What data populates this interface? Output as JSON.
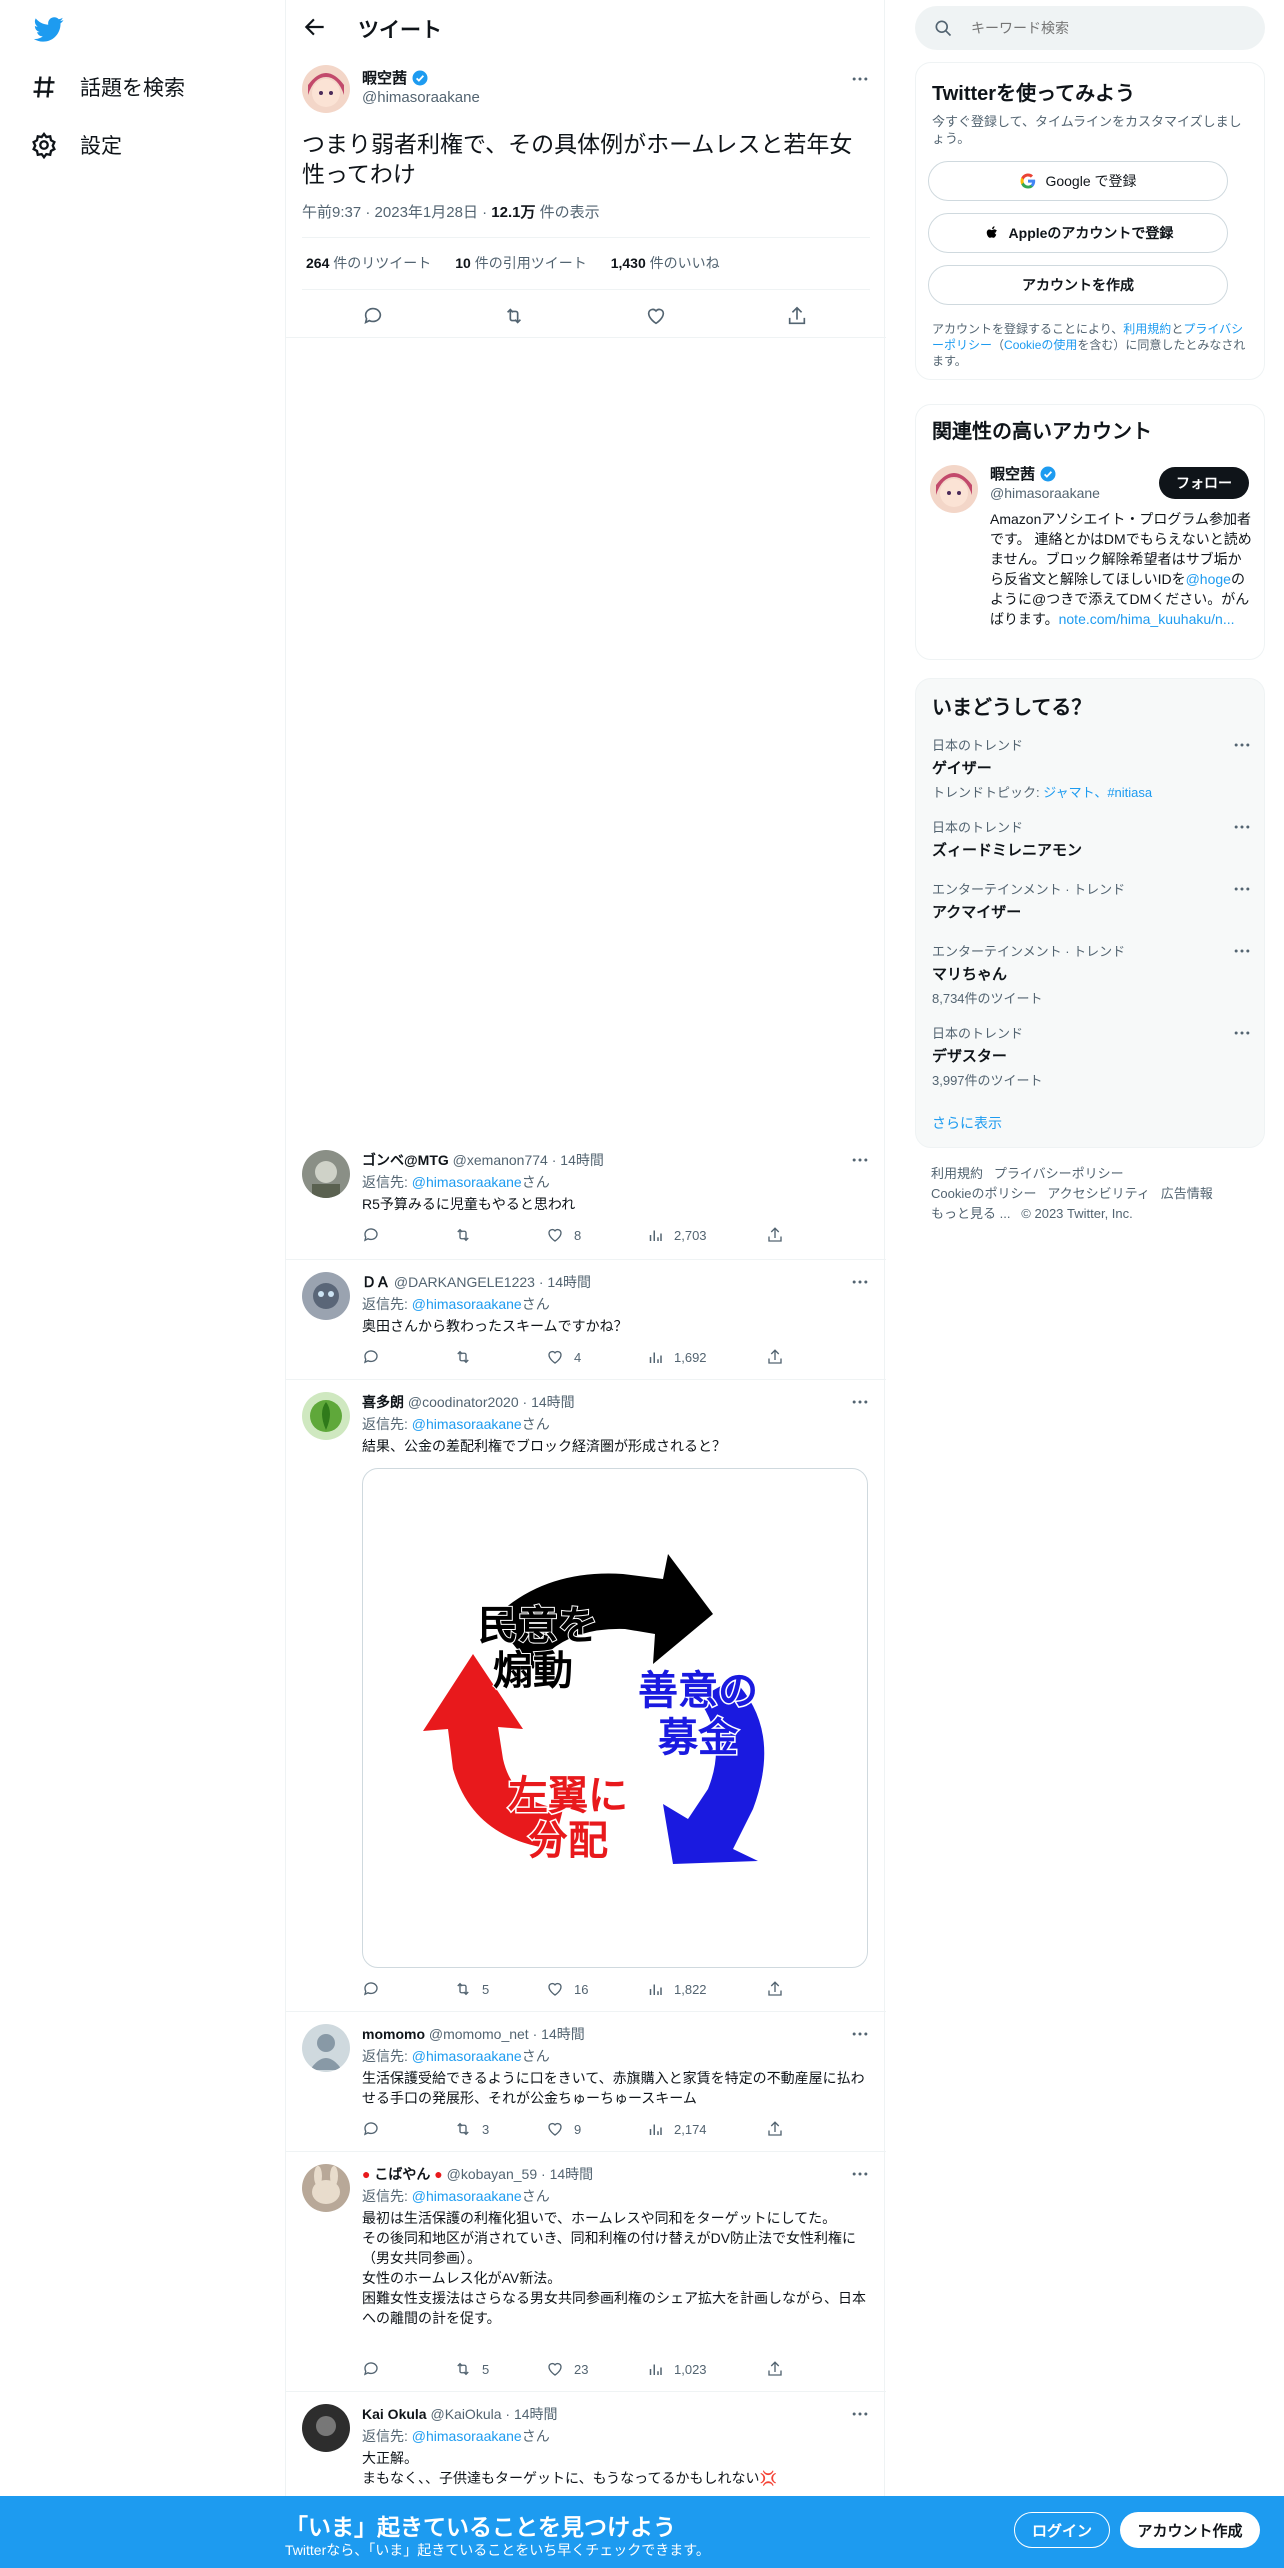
{
  "nav": {
    "explore_label": "話題を検索",
    "settings_label": "設定"
  },
  "header": {
    "title": "ツイート"
  },
  "main_tweet": {
    "name": "暇空茜",
    "handle": "@himasoraakane",
    "text": "つまり弱者利権で、その具体例がホームレスと若年女性ってわけ",
    "time": "午前9:37",
    "date": "2023年1月28日",
    "views_count": "12.1万",
    "views_label": "件の表示",
    "retweets_count": "264",
    "retweets_label": "件のリツイート",
    "quotes_count": "10",
    "quotes_label": "件の引用ツイート",
    "likes_count": "1,430",
    "likes_label": "件のいいね"
  },
  "replies": [
    {
      "name": "ゴンベ@MTG",
      "handle": "@xemanon774",
      "time": "14時間",
      "reply_prefix": "返信先: ",
      "reply_to": "@himasoraakane",
      "reply_suffix": "さん",
      "text": "R5予算みるに児童もやると思われ",
      "retweets": "",
      "likes": "8",
      "views": "2,703"
    },
    {
      "name": "ＤＡ",
      "handle": "@DARKANGELE1223",
      "time": "14時間",
      "reply_prefix": "返信先: ",
      "reply_to": "@himasoraakane",
      "reply_suffix": "さん",
      "text": "奥田さんから教わったスキームですかね？",
      "retweets": "",
      "likes": "4",
      "views": "1,692"
    },
    {
      "name": "喜多朗",
      "handle": "@coodinator2020",
      "time": "14時間",
      "reply_prefix": "返信先: ",
      "reply_to": "@himasoraakane",
      "reply_suffix": "さん",
      "text": "結果、公金の差配利権でブロック経済圏が形成されると？",
      "retweets": "5",
      "likes": "16",
      "views": "1,822",
      "image": {
        "label_top": "民意を煽動",
        "label_top_1": "民意を",
        "label_top_2": "煽動",
        "label_right_1": "善意の",
        "label_right_2": "募金",
        "label_bottom_1": "左翼に",
        "label_bottom_2": "分配",
        "colors": {
          "black": "#000000",
          "blue": "#1a1ae0",
          "red": "#e8191c"
        }
      }
    },
    {
      "name": "momomo",
      "handle": "@momomo_net",
      "time": "14時間",
      "reply_prefix": "返信先: ",
      "reply_to": "@himasoraakane",
      "reply_suffix": "さん",
      "text": "生活保護受給できるように口をきいて、赤旗購入と家賃を特定の不動産屋に払わせる手口の発展形、それが公金ちゅーちゅースキーム",
      "retweets": "3",
      "likes": "9",
      "views": "2,174"
    },
    {
      "name": "こばやん",
      "handle": "@kobayan_59",
      "time": "14時間",
      "reply_prefix": "返信先: ",
      "reply_to": "@himasoraakane",
      "reply_suffix": "さん",
      "text_lines": [
        "最初は生活保護の利権化狙いで、ホームレスや同和をターゲットにしてた。",
        "その後同和地区が消されていき、同和利権の付け替えがDV防止法で女性利権に（男女共同参画）。",
        "女性のホームレス化がAV新法。",
        "困難女性支援法はさらなる男女共同参画利権のシェア拡大を計画しながら、日本への離間の計を促す。"
      ],
      "retweets": "5",
      "likes": "23",
      "views": "1,023"
    },
    {
      "name": "Kai Okula",
      "handle": "@KaiOkula",
      "time": "14時間",
      "reply_prefix": "返信先: ",
      "reply_to": "@himasoraakane",
      "reply_suffix": "さん",
      "text_lines": [
        "大正解。",
        "まもなく、、子供達もターゲットに、もうなってるかもしれない💢"
      ]
    }
  ],
  "search": {
    "placeholder": "キーワード検索"
  },
  "signup_panel": {
    "title": "Twitterを使ってみよう",
    "subtitle": "今すぐ登録して、タイムラインをカスタマイズしましょう。",
    "google_label": "Google で登録",
    "apple_label": "Appleのアカウントで登録",
    "create_label": "アカウントを作成",
    "terms_pre": "アカウントを登録することにより、",
    "terms_link": "利用規約",
    "terms_mid": "と",
    "privacy_link": "プライバシーポリシー",
    "cookie_pre": "（",
    "cookie_link": "Cookieの使用",
    "terms_post": "を含む）に同意したとみなされます。"
  },
  "related_panel": {
    "title": "関連性の高いアカウント",
    "name": "暇空茜",
    "handle": "@himasoraakane",
    "follow_label": "フォロー",
    "bio_1": "Amazonアソシエイト・プログラム参加者です。 連絡とかはDMでもらえないと読めません。ブロック解除希望者はサブ垢から反省文と解除してほしいIDを",
    "bio_link": "@hoge",
    "bio_2": "のように@つきで添えてDMください。がんばります。",
    "bio_url": "note.com/hima_kuuhaku/n..."
  },
  "trends_panel": {
    "title": "いまどうしてる？",
    "items": [
      {
        "category": "日本のトレンド",
        "name": "ゲイザー",
        "extra_prefix": "トレンドトピック: ",
        "extra_links": "ジャマト、#nitiasa"
      },
      {
        "category": "日本のトレンド",
        "name": "ズィードミレニアモン",
        "extra": ""
      },
      {
        "category": "エンターテインメント · トレンド",
        "name": "アクマイザー",
        "extra": ""
      },
      {
        "category": "エンターテインメント · トレンド",
        "name": "マリちゃん",
        "extra": "8,734件のツイート"
      },
      {
        "category": "日本のトレンド",
        "name": "デザスター",
        "extra": "3,997件のツイート"
      }
    ],
    "show_more": "さらに表示"
  },
  "footer": {
    "terms": "利用規約",
    "privacy": "プライバシーポリシー",
    "cookie": "Cookieのポリシー",
    "accessibility": "アクセシビリティ",
    "ads": "広告情報",
    "more": "もっと見る ...",
    "copyright": "© 2023 Twitter, Inc."
  },
  "bottom_bar": {
    "title": "「いま」起きていることを見つけよう",
    "subtitle": "Twitterなら、「いま」起きていることをいち早くチェックできます。",
    "login_label": "ログイン",
    "signup_label": "アカウント作成"
  },
  "colors": {
    "accent": "#1d9bf0",
    "text": "#0f1419",
    "secondary": "#536471"
  }
}
